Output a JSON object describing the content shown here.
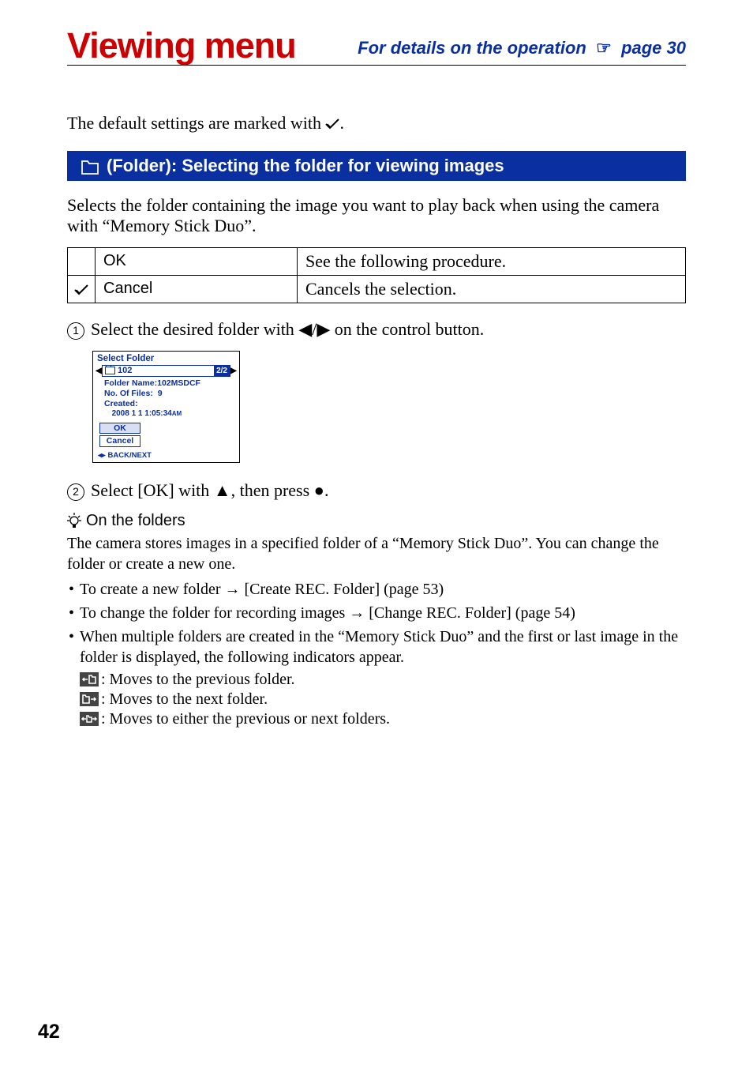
{
  "header": {
    "title": "Viewing menu",
    "right_prefix": "For details on the operation",
    "right_page_ref": "page 30"
  },
  "intro": {
    "text_before_icon": "The default settings are marked with ",
    "text_after_icon": "."
  },
  "section": {
    "title": "(Folder): Selecting the folder for viewing images",
    "description": "Selects the folder containing the image you want to play back when using the camera with “Memory Stick Duo”."
  },
  "options_table": {
    "rows": [
      {
        "has_check": false,
        "label": "OK",
        "desc": "See the following procedure."
      },
      {
        "has_check": true,
        "label": "Cancel",
        "desc": "Cancels the selection."
      }
    ]
  },
  "steps": {
    "s1_before": "Select the desired folder with ",
    "s1_mid": "/",
    "s1_after": " on the control button.",
    "s2_before": "Select [OK] with ",
    "s2_mid": ", then press ",
    "s2_after": "."
  },
  "lcd": {
    "title": "Select Folder",
    "folder_num": "102",
    "page_indicator": "2/2",
    "folder_name_label": "Folder Name:",
    "folder_name_value": "102MSDCF",
    "files_label": "No. Of Files:",
    "files_value": "9",
    "created_label": "Created:",
    "created_value": "2008   1   1   1:05:34",
    "created_ampm": "AM",
    "btn_ok": "OK",
    "btn_cancel": "Cancel",
    "footer": "BACK/NEXT"
  },
  "tip": {
    "heading": "On the folders",
    "body": "The camera stores images in a specified folder of a “Memory Stick Duo”. You can change the folder or create a new one.",
    "bullets": [
      "To create a new folder → [Create REC. Folder] (page 53)",
      "To change the folder for recording images → [Change REC. Folder] (page 54)",
      "When multiple folders are created in the “Memory Stick Duo” and the first or last image in the folder is displayed, the following indicators appear."
    ],
    "indicators": [
      ": Moves to the previous folder.",
      ": Moves to the next folder.",
      ": Moves to either the previous or next folders."
    ]
  },
  "page_number": "42"
}
